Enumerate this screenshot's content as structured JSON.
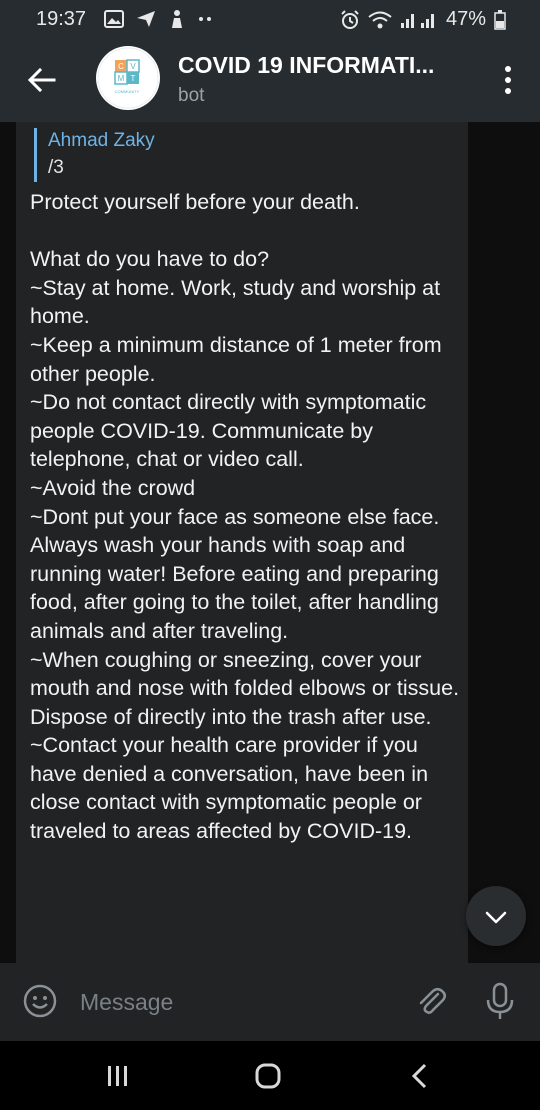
{
  "status_bar": {
    "time": "19:37",
    "battery": "47%"
  },
  "header": {
    "title": "COVID 19 INFORMATI...",
    "subtitle": "bot",
    "avatar_letters": [
      "C",
      "V",
      "M",
      "T"
    ],
    "avatar_caption": "COMMUNITY"
  },
  "message": {
    "reply_name": "Ahmad Zaky",
    "reply_text": "/3",
    "text": "Protect yourself before your death.\n\nWhat do you have to do?\n~Stay at home. Work, study and worship at home.\n~Keep a minimum distance of 1 meter from other people.\n~Do not contact directly with symptomatic people COVID-19. Communicate by telephone, chat or video call.\n~Avoid the crowd\n~Dont put your face as someone else face.\nAlways wash your hands with soap and running water! Before eating and preparing food, after going to the toilet, after handling animals and after traveling.\n~When coughing or sneezing, cover your mouth and nose with folded elbows or tissue. Dispose of directly into the trash after use.\n~Contact your health care provider if you have denied a conversation, have been in close contact with symptomatic people or traveled to areas affected by COVID-19."
  },
  "input": {
    "placeholder": "Message"
  },
  "colors": {
    "header_bg": "#262c30",
    "bubble_bg": "#212325",
    "accent": "#6fb2e6",
    "chat_bg": "#0e0e0e"
  },
  "icons": [
    "gallery-icon",
    "send-status-icon",
    "hand-icon",
    "more-notifications-icon",
    "alarm-icon",
    "wifi-icon",
    "signal-icon",
    "battery-icon",
    "back-arrow-icon",
    "more-vert-icon",
    "chevron-down-icon",
    "emoji-icon",
    "attach-icon",
    "mic-icon",
    "recent-apps-icon",
    "home-icon",
    "nav-back-icon"
  ]
}
